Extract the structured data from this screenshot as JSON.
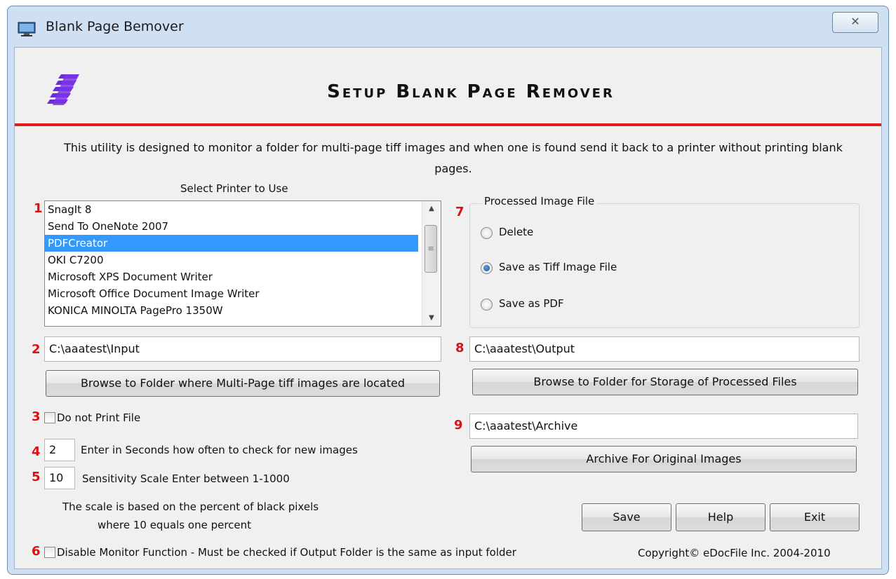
{
  "window": {
    "title": "Blank Page Bemover",
    "close_glyph": "✕"
  },
  "header": {
    "title": "Setup Blank Page Remover"
  },
  "intro": "This utility is designed to monitor a folder for multi-page tiff images and when one is found send it back to a printer without printing blank pages.",
  "printer": {
    "section_label": "Select Printer to Use",
    "items": [
      "SnagIt 8",
      "Send To OneNote 2007",
      "PDFCreator",
      "OKI C7200",
      "Microsoft XPS Document Writer",
      "Microsoft Office Document Image Writer",
      "KONICA MINOLTA PagePro 1350W"
    ],
    "selected_index": 2
  },
  "numbers": [
    "1",
    "2",
    "3",
    "4",
    "5",
    "6",
    "7",
    "8",
    "9"
  ],
  "input_folder": {
    "value": "C:\\aaatest\\Input",
    "browse_label": "Browse to Folder where Multi-Page tiff images are located"
  },
  "do_not_print": {
    "label": "Do not Print File",
    "checked": false
  },
  "check_interval": {
    "value": "2",
    "label": "Enter in Seconds how often to check for new images"
  },
  "sensitivity": {
    "value": "10",
    "label": "Sensitivity Scale Enter between 1-1000",
    "note_line1": "The scale is based on the percent of black pixels",
    "note_line2": "where 10 equals one percent"
  },
  "disable_monitor": {
    "label": "Disable Monitor Function - Must be checked if Output Folder is the same as input folder",
    "checked": false
  },
  "processed": {
    "legend": "Processed Image File",
    "options": [
      "Delete",
      "Save as Tiff Image File",
      "Save as PDF"
    ],
    "selected_index": 1
  },
  "output_folder": {
    "value": "C:\\aaatest\\Output",
    "browse_label": "Browse to Folder for Storage of Processed Files"
  },
  "archive_folder": {
    "value": "C:\\aaatest\\Archive",
    "button_label": "Archive For Original Images"
  },
  "actions": {
    "save": "Save",
    "help": "Help",
    "exit": "Exit"
  },
  "copyright": "Copyright© eDocFile Inc. 2004-2010"
}
